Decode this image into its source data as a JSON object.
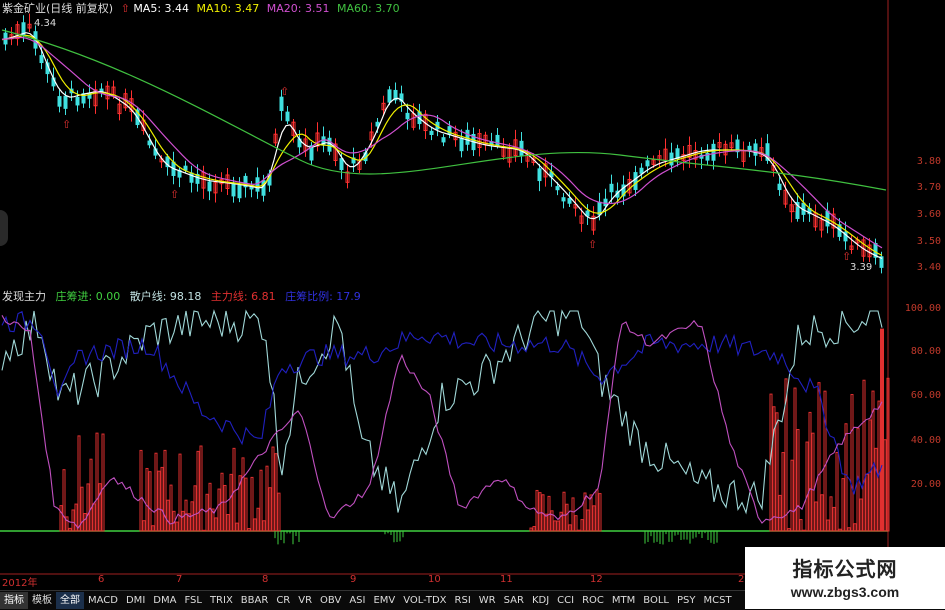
{
  "stock": {
    "name": "紫金矿业(日线 前复权)"
  },
  "ma": [
    {
      "label": "MA5: 3.44",
      "color": "#ffffff"
    },
    {
      "label": "MA10: 3.47",
      "color": "#f0f000"
    },
    {
      "label": "MA20: 3.51",
      "color": "#d050d0"
    },
    {
      "label": "MA60: 3.70",
      "color": "#40c040"
    }
  ],
  "price_axis": [
    "3.80",
    "3.70",
    "3.60",
    "3.50",
    "3.40"
  ],
  "high_label": "4.34",
  "low_label": "3.39",
  "indicator": {
    "name": "发现主力",
    "values": [
      {
        "label": "庄筹进: 0.00",
        "color": "#40d040"
      },
      {
        "label": "散户线: 98.18",
        "color": "#c0e0e0"
      },
      {
        "label": "主力线: 6.81",
        "color": "#e03030"
      },
      {
        "label": "庄筹比例: 17.9",
        "color": "#3030e0"
      }
    ]
  },
  "ind_axis": [
    "100.00",
    "80.00",
    "60.00",
    "40.00",
    "20.00"
  ],
  "dates": [
    "2012年",
    "6",
    "7",
    "8",
    "9",
    "10",
    "11",
    "12",
    "2"
  ],
  "tabs": [
    "指标",
    "模板",
    "全部",
    "MACD",
    "DMI",
    "DMA",
    "FSL",
    "TRIX",
    "BBAR",
    "CR",
    "VR",
    "OBV",
    "ASI",
    "EMV",
    "VOL-TDX",
    "RSI",
    "WR",
    "SAR",
    "KDJ",
    "CCI",
    "ROC",
    "MTM",
    "BOLL",
    "PSY",
    "MCST"
  ],
  "active_tab": "全部",
  "watermark": {
    "title": "指标公式网",
    "url": "www.zbgs3.com"
  },
  "colors": {
    "up": "#ff3030",
    "down": "#40e0e0",
    "ma5": "#ffffff",
    "ma10": "#f0f000",
    "ma20": "#d050d0",
    "ma60": "#40c040",
    "retail": "#a0d8d8",
    "main": "#c050c0",
    "ratio": "#2020c0",
    "bars": "#e03030",
    "green": "#40d040"
  }
}
